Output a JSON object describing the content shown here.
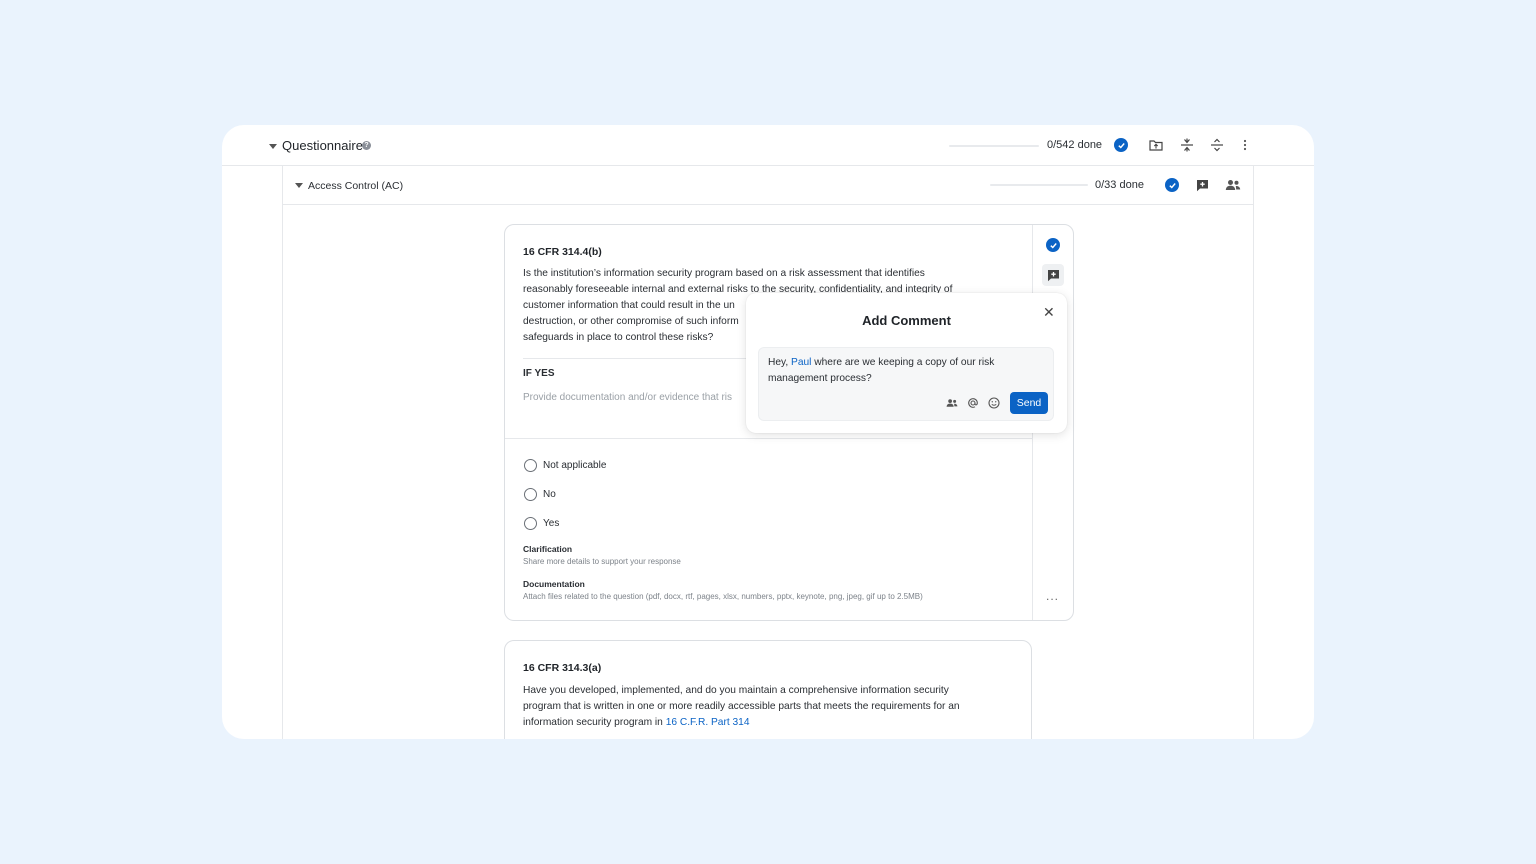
{
  "header": {
    "title": "Questionnaire",
    "help_icon": "?",
    "progress": {
      "done": 0,
      "total": 542,
      "label": "0/542 done"
    },
    "icons": [
      "check-circle-icon",
      "folder-upload-icon",
      "collapse-all-icon",
      "expand-all-icon",
      "more-vertical-icon"
    ]
  },
  "section": {
    "title": "Access Control (AC)",
    "progress": {
      "done": 0,
      "total": 33,
      "label": "0/33 done"
    },
    "icons": [
      "check-circle-icon",
      "add-comment-icon",
      "assign-users-icon"
    ]
  },
  "question1": {
    "code": "16 CFR 314.4(b)",
    "text_lines": [
      "Is the institution’s information security program based on a risk assessment that identifies",
      "reasonably foreseeable internal and external risks to the security, confidentiality, and integrity of",
      "customer information that could result in the un",
      "destruction, or other compromise of such inform",
      "safeguards in place to control these risks?"
    ],
    "if_yes_label": "IF YES",
    "if_yes_text": "Provide documentation and/or evidence that ris",
    "options": [
      "Not applicable",
      "No",
      "Yes"
    ],
    "clarification_label": "Clarification",
    "clarification_help": "Share more details to support your response",
    "documentation_label": "Documentation",
    "documentation_help": "Attach files related to the question (pdf, docx, rtf, pages, xlsx, numbers, pptx, keynote, png, jpeg, gif up to 2.5MB)",
    "more": "..."
  },
  "question2": {
    "code": "16 CFR 314.3(a)",
    "text_lines": [
      "Have you developed, implemented, and do you maintain a comprehensive information security",
      "program that is written in one or more readily accessible parts that meets the requirements for an"
    ],
    "text_line3_prefix": "information security program in ",
    "link": "16 C.F.R. Part 314"
  },
  "comment_popup": {
    "title": "Add Comment",
    "close": "✕",
    "text_prefix": "Hey, ",
    "mention": "Paul",
    "text_rest": " where are we keeping a copy of our risk",
    "text_line2": "management process?",
    "send_label": "Send",
    "tool_icons": [
      "assign-users-icon",
      "at-mention-icon",
      "emoji-icon"
    ]
  },
  "colors": {
    "accent": "#0b63c5",
    "background": "#eaf3fd",
    "panel": "#ffffff"
  }
}
